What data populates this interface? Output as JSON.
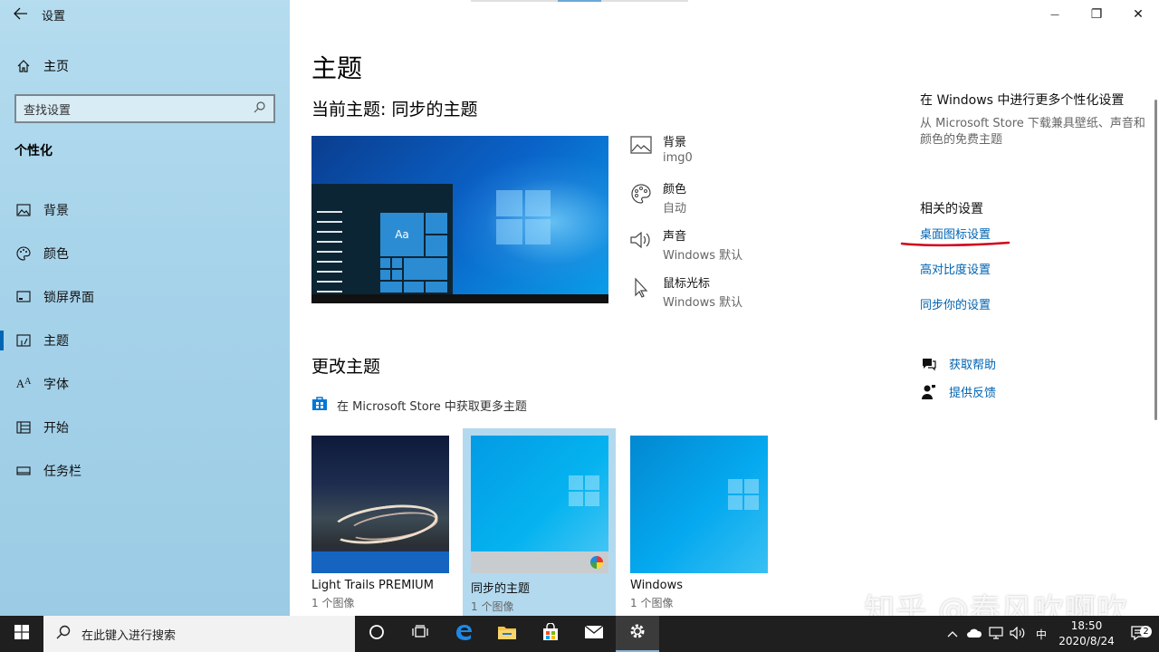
{
  "window": {
    "title": "设置",
    "controls": {
      "minimize": "—",
      "maximize": "❐",
      "close": "✕"
    }
  },
  "sidebar": {
    "home": "主页",
    "search_placeholder": "查找设置",
    "section": "个性化",
    "items": [
      {
        "label": "背景",
        "icon": "image-icon"
      },
      {
        "label": "颜色",
        "icon": "palette-icon"
      },
      {
        "label": "锁屏界面",
        "icon": "lockscreen-icon"
      },
      {
        "label": "主题",
        "icon": "theme-icon",
        "active": true
      },
      {
        "label": "字体",
        "icon": "font-icon"
      },
      {
        "label": "开始",
        "icon": "start-icon"
      },
      {
        "label": "任务栏",
        "icon": "taskbar-icon"
      }
    ]
  },
  "main": {
    "title": "主题",
    "current_theme": "当前主题: 同步的主题",
    "preview_tile_text": "Aa",
    "properties": [
      {
        "label": "背景",
        "value": "img0"
      },
      {
        "label": "颜色",
        "value": "自动"
      },
      {
        "label": "声音",
        "value": "Windows 默认"
      },
      {
        "label": "鼠标光标",
        "value": "Windows 默认"
      }
    ],
    "change_theme": "更改主题",
    "store_link": "在 Microsoft Store 中获取更多主题",
    "themes": [
      {
        "name": "Light Trails PREMIUM",
        "count": "1 个图像"
      },
      {
        "name": "同步的主题",
        "count": "1 个图像",
        "selected": true
      },
      {
        "name": "Windows",
        "count": "1 个图像"
      }
    ]
  },
  "right": {
    "title": "在 Windows 中进行更多个性化设置",
    "desc": "从 Microsoft Store 下载兼具壁纸、声音和颜色的免费主题",
    "related": "相关的设置",
    "links": [
      "桌面图标设置",
      "高对比度设置",
      "同步你的设置"
    ],
    "help": "获取帮助",
    "feedback": "提供反馈"
  },
  "watermark": "知乎 @春风吹啊吹",
  "taskbar": {
    "search": "在此键入进行搜索",
    "time": "18:50",
    "date": "2020/8/24",
    "ime": "中",
    "notifications": "2"
  },
  "colors": {
    "accent": "#0063b1",
    "taskbar": "#1f1f1f",
    "annotation": "#d0021b"
  }
}
